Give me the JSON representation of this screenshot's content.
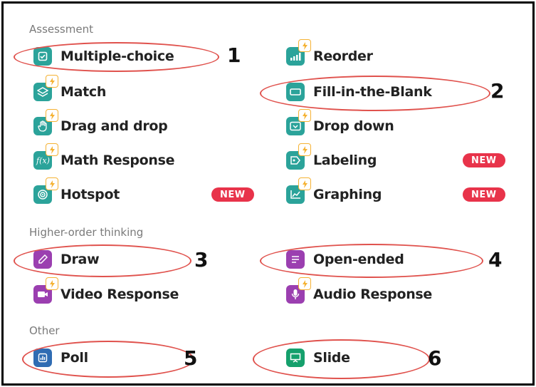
{
  "sections": {
    "assessment": "Assessment",
    "higher_order": "Higher-order thinking",
    "other": "Other"
  },
  "items": {
    "multiple_choice": "Multiple-choice",
    "reorder": "Reorder",
    "match": "Match",
    "fill_blank": "Fill-in-the-Blank",
    "drag_drop": "Drag and drop",
    "drop_down": "Drop down",
    "math_response": "Math Response",
    "labeling": "Labeling",
    "hotspot": "Hotspot",
    "graphing": "Graphing",
    "draw": "Draw",
    "open_ended": "Open-ended",
    "video_response": "Video Response",
    "audio_response": "Audio Response",
    "poll": "Poll",
    "slide": "Slide"
  },
  "badges": {
    "new": "NEW"
  },
  "annotations": [
    "1",
    "2",
    "3",
    "4",
    "5",
    "6"
  ],
  "icons": {
    "multiple_choice": "checkbox-icon",
    "reorder": "bars-icon",
    "match": "layers-icon",
    "fill_blank": "textbox-icon",
    "drag_drop": "hand-icon",
    "drop_down": "dropdown-icon",
    "math_response": "function-icon",
    "labeling": "label-icon",
    "hotspot": "target-icon",
    "graphing": "graph-icon",
    "draw": "pen-icon",
    "open_ended": "lines-icon",
    "video_response": "video-icon",
    "audio_response": "mic-icon",
    "poll": "chart-icon",
    "slide": "presentation-icon",
    "premium": "lightning-icon"
  },
  "colors": {
    "teal": "#2ba39a",
    "purple": "#9b3fb0",
    "blue": "#2f6cb3",
    "green": "#15a06c",
    "badge": "#e8334a",
    "lightning": "#f5b233",
    "annotation_oval": "#e0524d"
  }
}
